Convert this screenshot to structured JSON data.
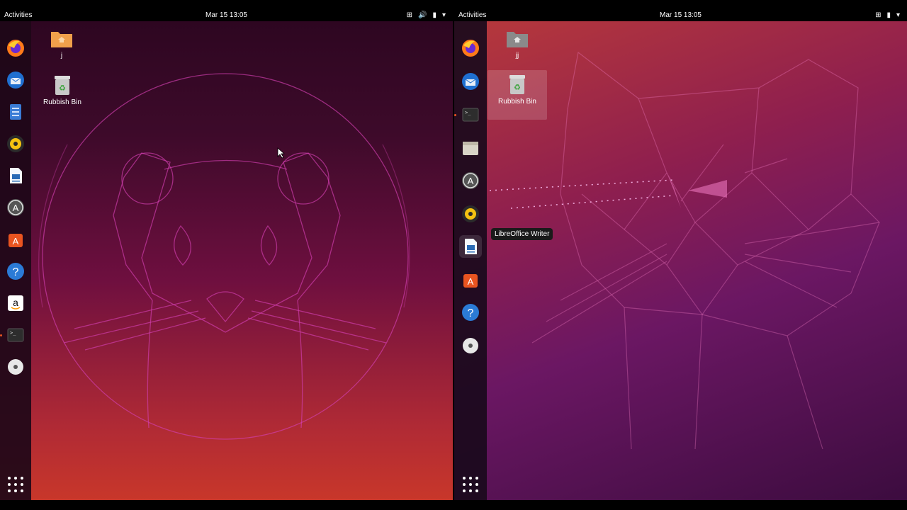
{
  "left": {
    "topbar": {
      "activities": "Activities",
      "clock": "Mar 15  13:05"
    },
    "desktop": {
      "home_label": "j",
      "trash_label": "Rubbish Bin"
    },
    "dock": [
      "firefox-icon",
      "thunderbird-icon",
      "files-icon",
      "rhythmbox-icon",
      "writer-icon",
      "software-updater-icon",
      "ubuntu-software-icon",
      "help-icon",
      "amazon-icon",
      "terminal-icon",
      "dvd-icon",
      "show-apps-icon"
    ]
  },
  "right": {
    "topbar": {
      "activities": "Activities",
      "clock": "Mar 15  13:05"
    },
    "desktop": {
      "home_label": "jj",
      "trash_label": "Rubbish Bin"
    },
    "tooltip": "LibreOffice Writer",
    "dock": [
      "firefox-icon",
      "thunderbird-icon",
      "terminal-icon",
      "files-icon",
      "software-updater-icon",
      "rhythmbox-icon",
      "writer-icon",
      "ubuntu-software-icon",
      "help-icon",
      "dvd-icon",
      "show-apps-icon"
    ]
  },
  "colors": {
    "accent": "#e95420",
    "topbar": "#000000"
  }
}
